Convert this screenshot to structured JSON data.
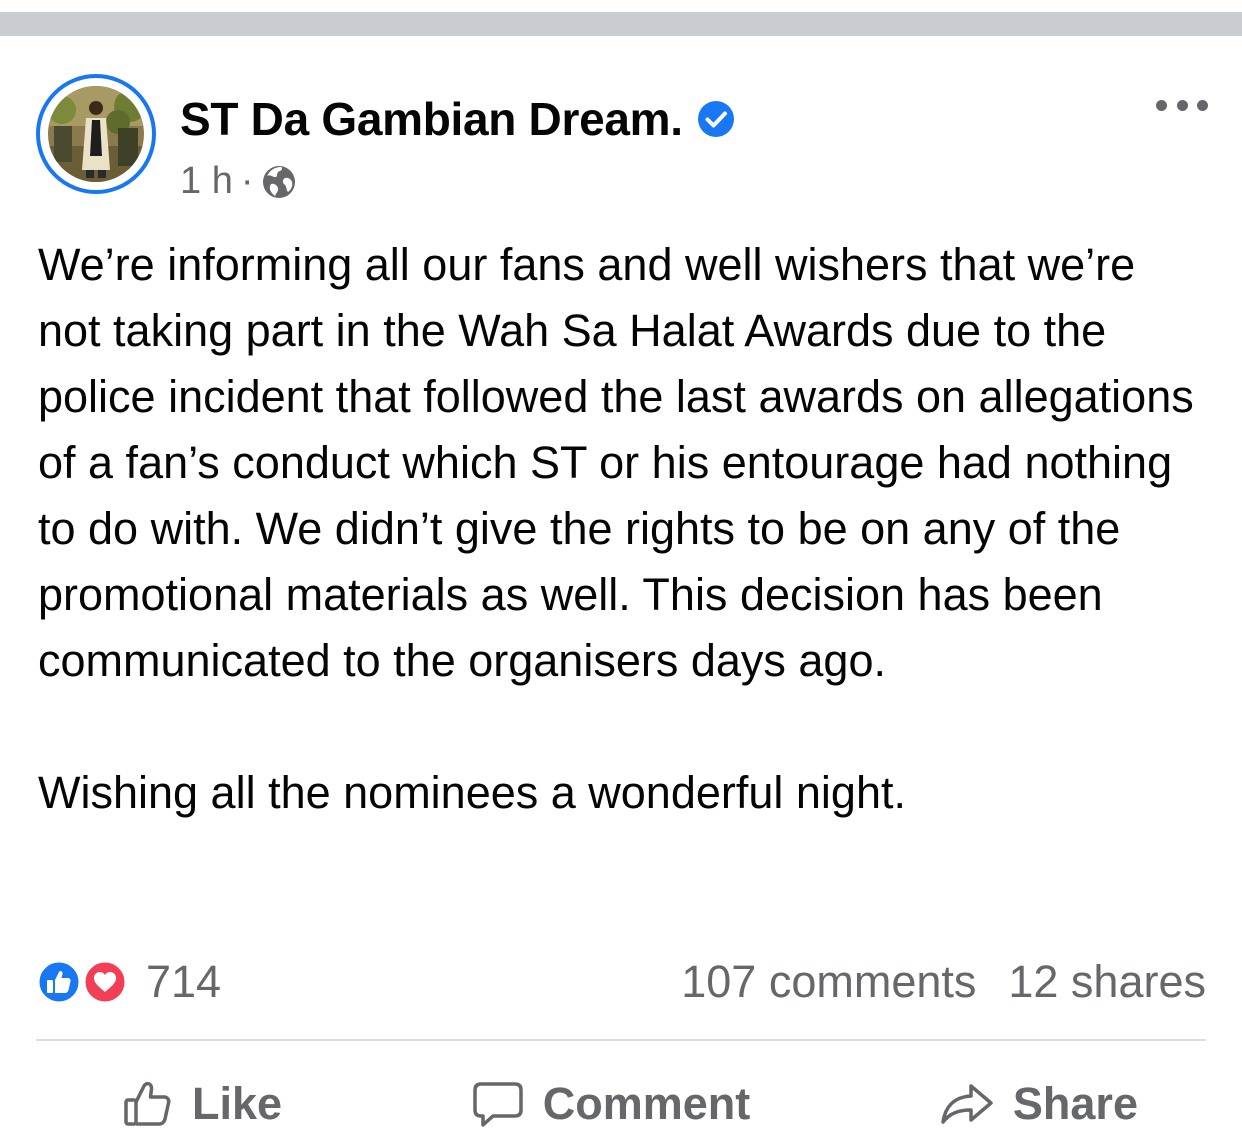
{
  "post": {
    "author": "ST Da Gambian Dream.",
    "time": "1 h",
    "separator": "·",
    "body_paragraphs": [
      "We’re informing all our fans and well wishers that we’re not taking part in the Wah Sa Halat Awards due to the police incident that followed the last awards on allegations of a fan’s conduct which ST or his entourage had nothing to do with. We didn’t give the rights to be on any of the promotional materials as well. This decision has been communicated to the organisers days ago.",
      "Wishing all the nominees a wonderful night."
    ]
  },
  "stats": {
    "reaction_count": "714",
    "comments": "107 comments",
    "shares": "12 shares"
  },
  "actions": {
    "like": "Like",
    "comment": "Comment",
    "share": "Share"
  },
  "icons": {
    "verified": "verified-badge-icon",
    "audience": "globe-icon",
    "more": "more-options-icon",
    "reaction_like": "like-reaction-icon",
    "reaction_love": "love-reaction-icon"
  },
  "colors": {
    "brand_blue": "#1877f2",
    "love_red": "#f33e58",
    "secondary_text": "#65676b",
    "divider": "#dadde1"
  }
}
